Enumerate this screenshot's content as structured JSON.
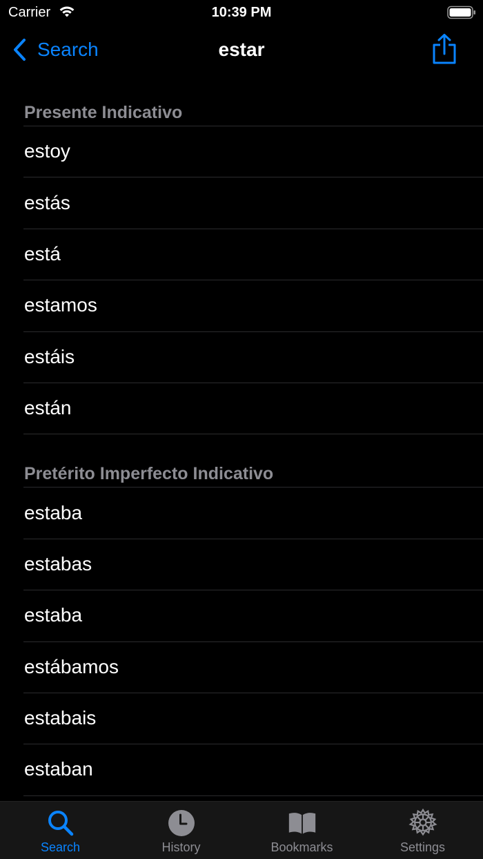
{
  "status_bar": {
    "carrier": "Carrier",
    "time": "10:39 PM"
  },
  "nav": {
    "back_label": "Search",
    "title": "estar"
  },
  "sections": [
    {
      "title": "Presente Indicativo",
      "rows": [
        "estoy",
        "estás",
        "está",
        "estamos",
        "estáis",
        "están"
      ]
    },
    {
      "title": "Pretérito Imperfecto Indicativo",
      "rows": [
        "estaba",
        "estabas",
        "estaba",
        "estábamos",
        "estabais",
        "estaban"
      ]
    }
  ],
  "tab_bar": {
    "tabs": [
      {
        "label": "Search",
        "icon": "search-icon",
        "active": true
      },
      {
        "label": "History",
        "icon": "clock-icon",
        "active": false
      },
      {
        "label": "Bookmarks",
        "icon": "book-icon",
        "active": false
      },
      {
        "label": "Settings",
        "icon": "gear-icon",
        "active": false
      }
    ]
  },
  "colors": {
    "accent": "#0a84ff",
    "background": "#000000",
    "secondary_text": "#8d8d93",
    "separator": "#2c2c2e",
    "tab_bar_bg": "#161616"
  }
}
